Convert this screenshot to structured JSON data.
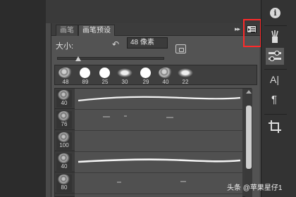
{
  "panel": {
    "tabs": [
      {
        "label": "画笔",
        "active": false
      },
      {
        "label": "画笔预设",
        "active": true
      }
    ],
    "collapse_glyph": "▸▸",
    "menu_icon": "panel-menu-icon"
  },
  "size": {
    "label": "大小:",
    "value": "48 像素",
    "reset_icon": "reset-icon",
    "slider_level": 0.2
  },
  "presets": [
    {
      "kind": "noise",
      "size": "48"
    },
    {
      "kind": "hard",
      "size": "89"
    },
    {
      "kind": "hard",
      "size": "25"
    },
    {
      "kind": "splat",
      "size": "30"
    },
    {
      "kind": "hard",
      "size": "29"
    },
    {
      "kind": "noise",
      "size": "40"
    },
    {
      "kind": "splat",
      "size": "22"
    }
  ],
  "brush_list": [
    {
      "size": "40",
      "stroke": "smooth"
    },
    {
      "size": "76",
      "stroke": "faint"
    },
    {
      "size": "100",
      "stroke": "none"
    },
    {
      "size": "40",
      "stroke": "smooth"
    },
    {
      "size": "80",
      "stroke": "faint"
    },
    {
      "size": "",
      "stroke": "none"
    }
  ],
  "dock": {
    "buttons": [
      "info-icon",
      "brush-icon",
      "brush-presets-icon",
      "character-icon",
      "paragraph-icon",
      "crop-icon"
    ],
    "text_glyph": "A|",
    "para_glyph": "¶",
    "info_glyph": "i"
  },
  "watermark": "头条 @苹果星仔1",
  "colors": {
    "highlight": "#ff2a2a",
    "panel_bg": "#535353"
  }
}
